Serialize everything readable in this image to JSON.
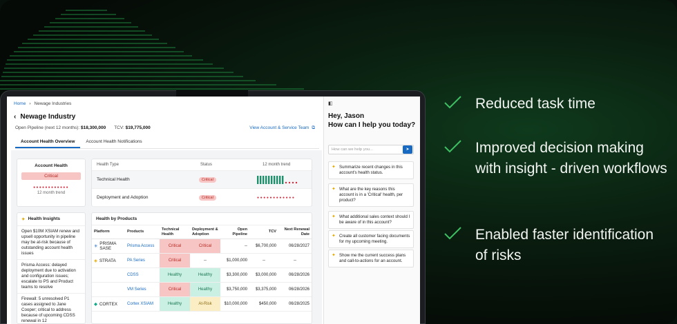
{
  "colors": {
    "accent": "#1769c2",
    "critical": "#d6283a",
    "healthy": "#1e7a55",
    "check": "#3fbf63"
  },
  "breadcrumb": {
    "home": "Home",
    "current": "Newage Industries"
  },
  "page_title": "Newage Industry",
  "pipeline": {
    "open_label": "Open Pipeline (next 12 months):",
    "open_value": "$18,300,000",
    "tcv_label": "TCV:",
    "tcv_value": "$19,775,000"
  },
  "view_link": "View Account & Service Team",
  "tabs": [
    "Account Health Overview",
    "Account Health Notifications"
  ],
  "account_health": {
    "title": "Account Health",
    "status": "Critical",
    "trend_label": "12 month trend"
  },
  "health_type": {
    "headers": [
      "Health Type",
      "Status",
      "12 month trend"
    ],
    "rows": [
      {
        "type": "Technical Health",
        "status": "Critical"
      },
      {
        "type": "Deployment and Adoption",
        "status": "Critical"
      }
    ]
  },
  "health_insights": {
    "title": "Health Insights",
    "items": [
      "Open $10M XSIAM renew and upsell opportunity in pipeline may be at-risk because of outstanding account health issues",
      "Prisma Access: delayed deployment due to activation and configuration issues; escalate to PS and Product teams to resolve",
      "Firewall: 5 unresolved P1 cases assigned to Jane Cooper; critical to address because of upcoming CDSS renewal in 12"
    ]
  },
  "health_by_products": {
    "title": "Health by Products",
    "headers": [
      "Platform",
      "Products",
      "Technical Health",
      "Deployment & Adoption",
      "Open Pipeline",
      "TCV",
      "Next Renewal Date"
    ],
    "platforms": [
      "PRISMA SASE",
      "STRATA",
      "CORTEX"
    ],
    "rows": [
      {
        "platform": "PRISMA SASE",
        "product": "Prisma Access",
        "tech": "Critical",
        "deploy": "Critical",
        "pipeline": "--",
        "tcv": "$6,700,000",
        "renewal": "06/28/2027"
      },
      {
        "platform": "STRATA",
        "product": "PA Series",
        "tech": "Critical",
        "deploy": "--",
        "pipeline": "$1,000,000",
        "tcv": "--",
        "renewal": "--"
      },
      {
        "platform": "",
        "product": "CDSS",
        "tech": "Healthy",
        "deploy": "Healthy",
        "pipeline": "$3,300,000",
        "tcv": "$3,000,000",
        "renewal": "06/28/2026"
      },
      {
        "platform": "",
        "product": "VM Series",
        "tech": "Critical",
        "deploy": "Healthy",
        "pipeline": "$3,750,000",
        "tcv": "$3,375,000",
        "renewal": "06/28/2026"
      },
      {
        "platform": "CORTEX",
        "product": "Cortex XSIAM",
        "tech": "Healthy",
        "deploy": "At-Risk",
        "pipeline": "$10,000,000",
        "tcv": "$450,000",
        "renewal": "06/28/2025"
      }
    ]
  },
  "chat": {
    "greeting_line1": "Hey, Jason",
    "greeting_line2": "How can I help you today?",
    "placeholder": "How can we help you...",
    "suggestions": [
      "Summarize recent changes in this account's health status.",
      "What are the key reasons this account is in a 'Critical' health, per product?",
      "What additional sales context should I be aware of in this account?",
      "Create all customer facing documents for my upcoming meeting.",
      "Show me the current success plans and call-to-actions for an account."
    ]
  },
  "benefits": [
    "Reduced task time",
    "Improved decision making with insight - driven workflows",
    "Enabled faster identification of risks"
  ]
}
